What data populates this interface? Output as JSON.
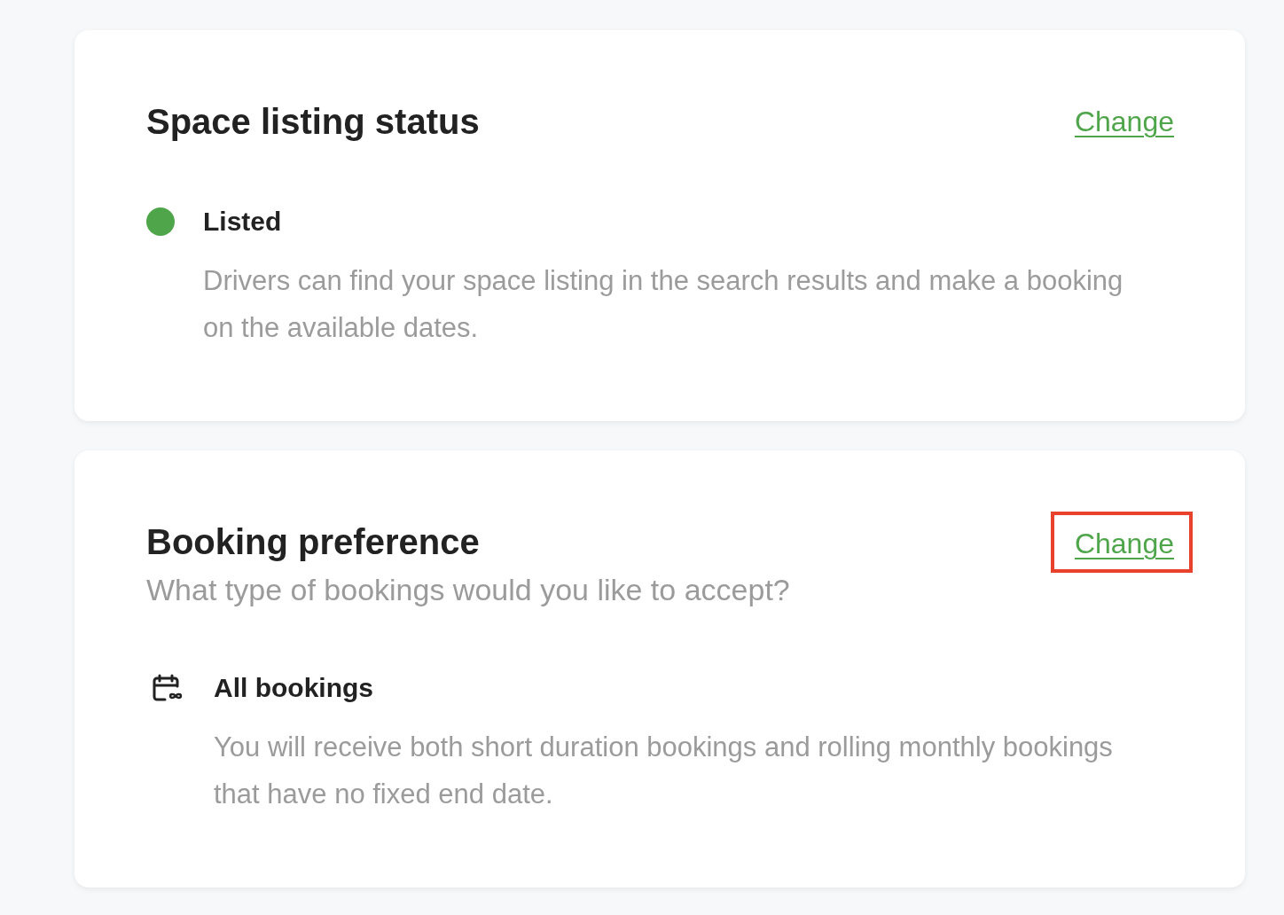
{
  "cards": [
    {
      "title": "Space listing status",
      "change_link": {
        "label": "Change",
        "highlighted": false
      },
      "entry": {
        "kind": "status",
        "label": "Listed",
        "color": "#4fa54a",
        "description": "Drivers can find your space listing in the search results and make a booking on the available dates."
      }
    },
    {
      "title": "Booking preference",
      "subtitle": "What type of bookings would you like to accept?",
      "change_link": {
        "label": "Change",
        "highlighted": true
      },
      "entry": {
        "kind": "option",
        "label": "All bookings",
        "description": "You will receive both short duration bookings and rolling monthly bookings that have no fixed end date."
      }
    }
  ]
}
